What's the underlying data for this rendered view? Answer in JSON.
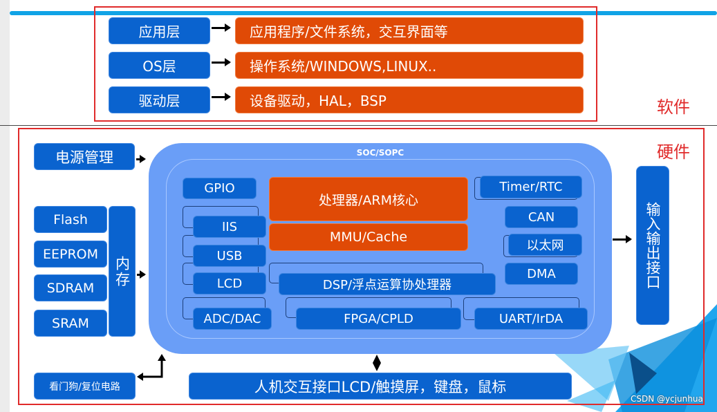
{
  "software": {
    "label": "软件",
    "layers": [
      {
        "name": "应用层",
        "desc": "应用程序/文件系统，交互界面等"
      },
      {
        "name": "OS层",
        "desc": "操作系统/WINDOWS,LINUX.."
      },
      {
        "name": "驱动层",
        "desc": "设备驱动，HAL，BSP"
      }
    ]
  },
  "hardware": {
    "label": "硬件",
    "power": "电源管理",
    "memory": {
      "label": "内存",
      "items": [
        "Flash",
        "EEPROM",
        "SDRAM",
        "SRAM"
      ]
    },
    "soc": {
      "title": "SOC/SOPC",
      "gpio": "GPIO",
      "cpu": "处理器/ARM核心",
      "mmu": "MMU/Cache",
      "iis": "IIS",
      "usb": "USB",
      "lcd": "LCD",
      "adc": "ADC/DAC",
      "dsp": "DSP/浮点运算协处理器",
      "fpga": "FPGA/CPLD",
      "uart": "UART/IrDA",
      "timer": "Timer/RTC",
      "can": "CAN",
      "ethernet": "以太网",
      "dma": "DMA"
    },
    "io": "输入输出接口",
    "watchdog": "看门狗/复位电路",
    "hmi": "人机交互接口LCD/触摸屏，键盘，鼠标"
  },
  "watermark": "CSDN @ycjunhua",
  "colors": {
    "blue": "#0a63cf",
    "orange": "#e04a06",
    "soc": "#6a9ef7",
    "red": "#e02a2a"
  }
}
